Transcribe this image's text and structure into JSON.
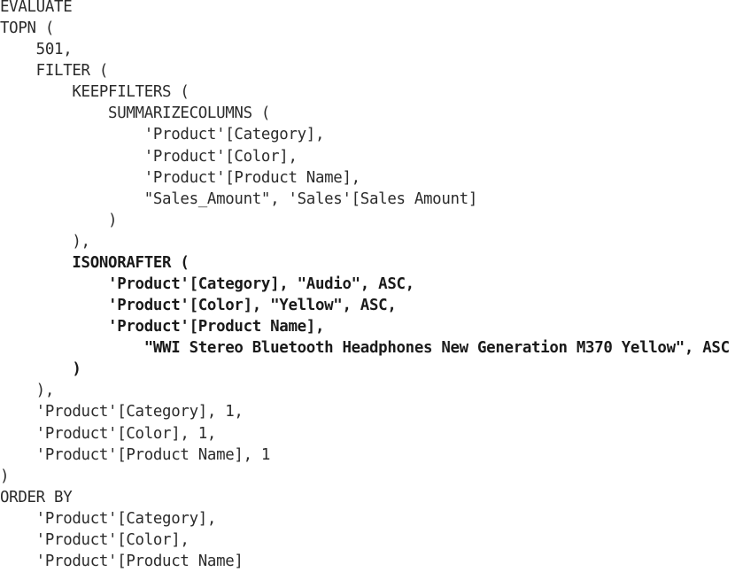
{
  "code": {
    "lines": [
      {
        "text": "EVALUATE",
        "bold": false
      },
      {
        "text": "TOPN (",
        "bold": false
      },
      {
        "text": "    501,",
        "bold": false
      },
      {
        "text": "    FILTER (",
        "bold": false
      },
      {
        "text": "        KEEPFILTERS (",
        "bold": false
      },
      {
        "text": "            SUMMARIZECOLUMNS (",
        "bold": false
      },
      {
        "text": "                'Product'[Category],",
        "bold": false
      },
      {
        "text": "                'Product'[Color],",
        "bold": false
      },
      {
        "text": "                'Product'[Product Name],",
        "bold": false
      },
      {
        "text": "                \"Sales_Amount\", 'Sales'[Sales Amount]",
        "bold": false
      },
      {
        "text": "            )",
        "bold": false
      },
      {
        "text": "        ),",
        "bold": false
      },
      {
        "text": "        ISONORAFTER (",
        "bold": true
      },
      {
        "text": "            'Product'[Category], \"Audio\", ASC,",
        "bold": true
      },
      {
        "text": "            'Product'[Color], \"Yellow\", ASC,",
        "bold": true
      },
      {
        "text": "            'Product'[Product Name],",
        "bold": true
      },
      {
        "text": "                \"WWI Stereo Bluetooth Headphones New Generation M370 Yellow\", ASC",
        "bold": true
      },
      {
        "text": "        )",
        "bold": true
      },
      {
        "text": "    ),",
        "bold": false
      },
      {
        "text": "    'Product'[Category], 1,",
        "bold": false
      },
      {
        "text": "    'Product'[Color], 1,",
        "bold": false
      },
      {
        "text": "    'Product'[Product Name], 1",
        "bold": false
      },
      {
        "text": ")",
        "bold": false
      },
      {
        "text": "ORDER BY",
        "bold": false
      },
      {
        "text": "    'Product'[Category],",
        "bold": false
      },
      {
        "text": "    'Product'[Color],",
        "bold": false
      },
      {
        "text": "    'Product'[Product Name]",
        "bold": false
      }
    ]
  }
}
